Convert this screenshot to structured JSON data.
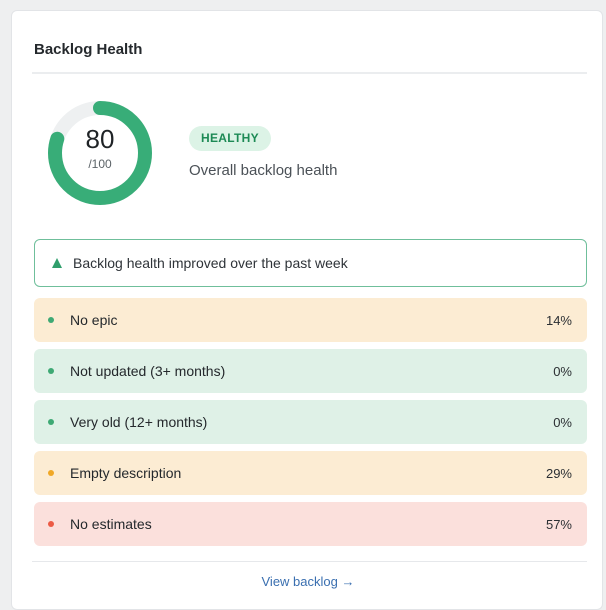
{
  "card": {
    "title": "Backlog Health"
  },
  "score": {
    "value": "80",
    "max_label": "/100",
    "fraction": 0.8,
    "color": "#38ad78",
    "track_color": "#eef0f1"
  },
  "status": {
    "badge": "HEALTHY",
    "caption": "Overall backlog health"
  },
  "trend": {
    "icon": "triangle-up-icon",
    "text": "Backlog health improved over the past week"
  },
  "metrics": [
    {
      "label": "No epic",
      "value": "14%",
      "bg": "#fcecd3",
      "dot": "#3ea974"
    },
    {
      "label": "Not updated (3+ months)",
      "value": "0%",
      "bg": "#dff1e7",
      "dot": "#3ea974"
    },
    {
      "label": "Very old (12+ months)",
      "value": "0%",
      "bg": "#dff1e7",
      "dot": "#3ea974"
    },
    {
      "label": "Empty description",
      "value": "29%",
      "bg": "#fcecd3",
      "dot": "#f0a826"
    },
    {
      "label": "No estimates",
      "value": "57%",
      "bg": "#fbe0dc",
      "dot": "#ec5a45"
    }
  ],
  "footer": {
    "link": "View backlog →"
  }
}
